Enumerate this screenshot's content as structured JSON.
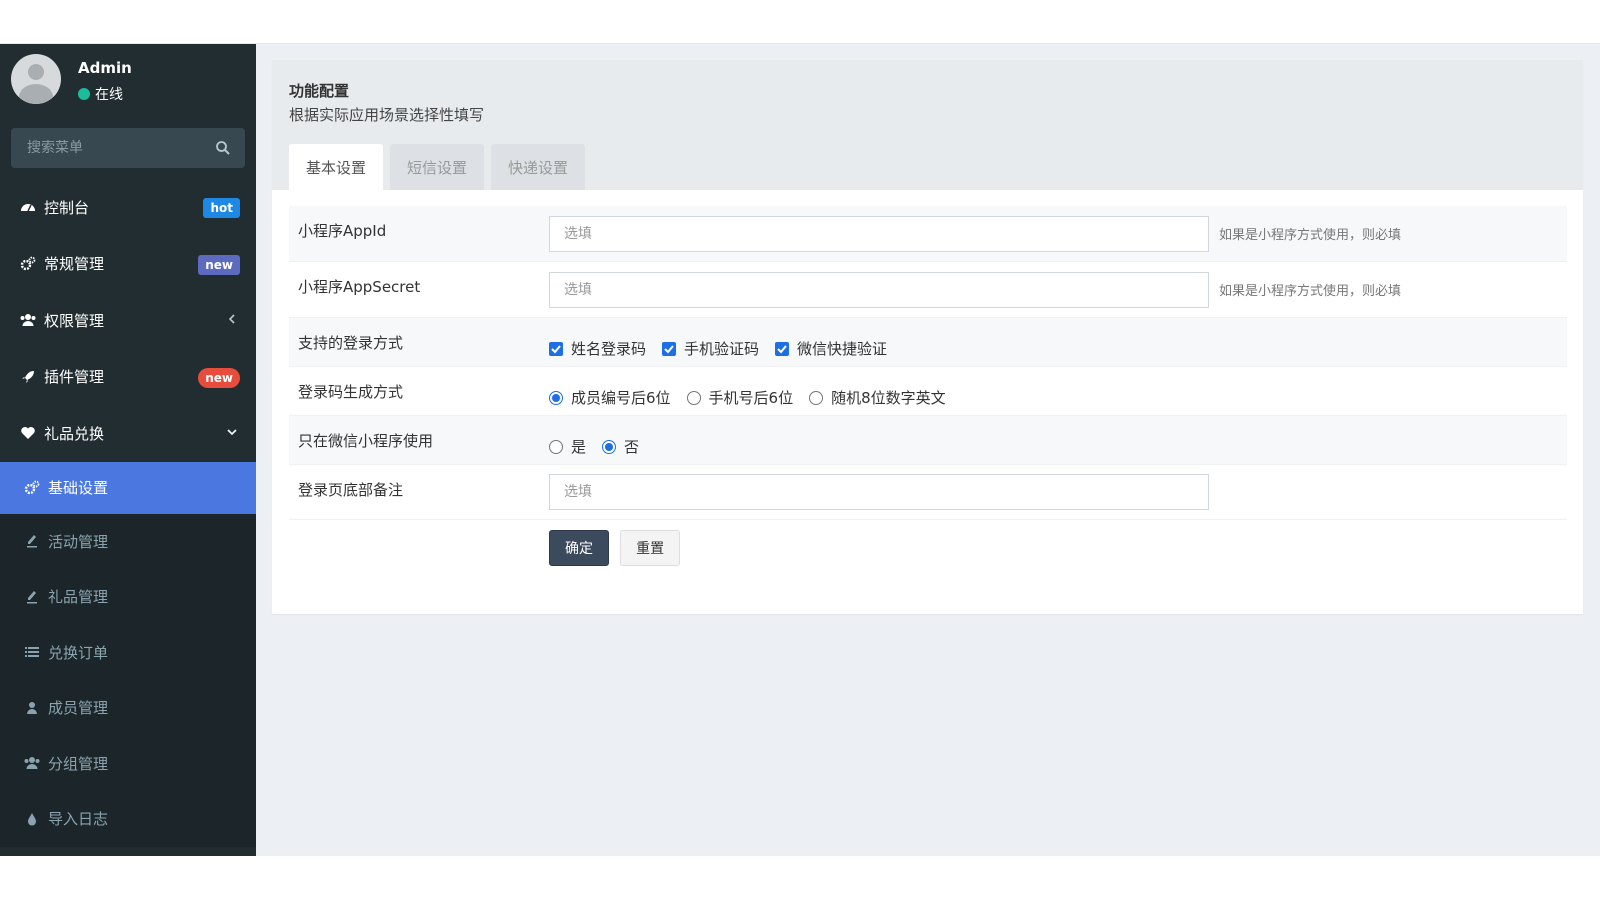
{
  "user": {
    "name": "Admin",
    "status": "在线"
  },
  "sidebar_search": {
    "placeholder": "搜索菜单"
  },
  "menu": {
    "dashboard": {
      "label": "控制台",
      "badge": "hot"
    },
    "general": {
      "label": "常规管理",
      "badge": "new"
    },
    "auth": {
      "label": "权限管理"
    },
    "addons": {
      "label": "插件管理",
      "badge": "new"
    },
    "gift": {
      "label": "礼品兑换"
    },
    "sub": {
      "basic": "基础设置",
      "activity": "活动管理",
      "gifts": "礼品管理",
      "orders": "兑换订单",
      "members": "成员管理",
      "groups": "分组管理",
      "import_log": "导入日志"
    }
  },
  "panel": {
    "title": "功能配置",
    "subtitle": "根据实际应用场景选择性填写",
    "tabs": [
      "基本设置",
      "短信设置",
      "快递设置"
    ]
  },
  "form": {
    "appid": {
      "label": "小程序AppId",
      "placeholder": "选填",
      "help": "如果是小程序方式使用，则必填"
    },
    "appsecret": {
      "label": "小程序AppSecret",
      "placeholder": "选填",
      "help": "如果是小程序方式使用，则必填"
    },
    "login_methods": {
      "label": "支持的登录方式",
      "options": [
        "姓名登录码",
        "手机验证码",
        "微信快捷验证"
      ]
    },
    "code_gen": {
      "label": "登录码生成方式",
      "options": [
        "成员编号后6位",
        "手机号后6位",
        "随机8位数字英文"
      ],
      "selected": "成员编号后6位"
    },
    "wechat_only": {
      "label": "只在微信小程序使用",
      "options": [
        "是",
        "否"
      ],
      "selected": "否"
    },
    "footer_note": {
      "label": "登录页底部备注",
      "placeholder": "选填"
    },
    "submit": "确定",
    "reset": "重置"
  },
  "colors": {
    "sidebar": "#222d32",
    "active": "#4a77e0",
    "primary_button": "#3c4a5e"
  }
}
